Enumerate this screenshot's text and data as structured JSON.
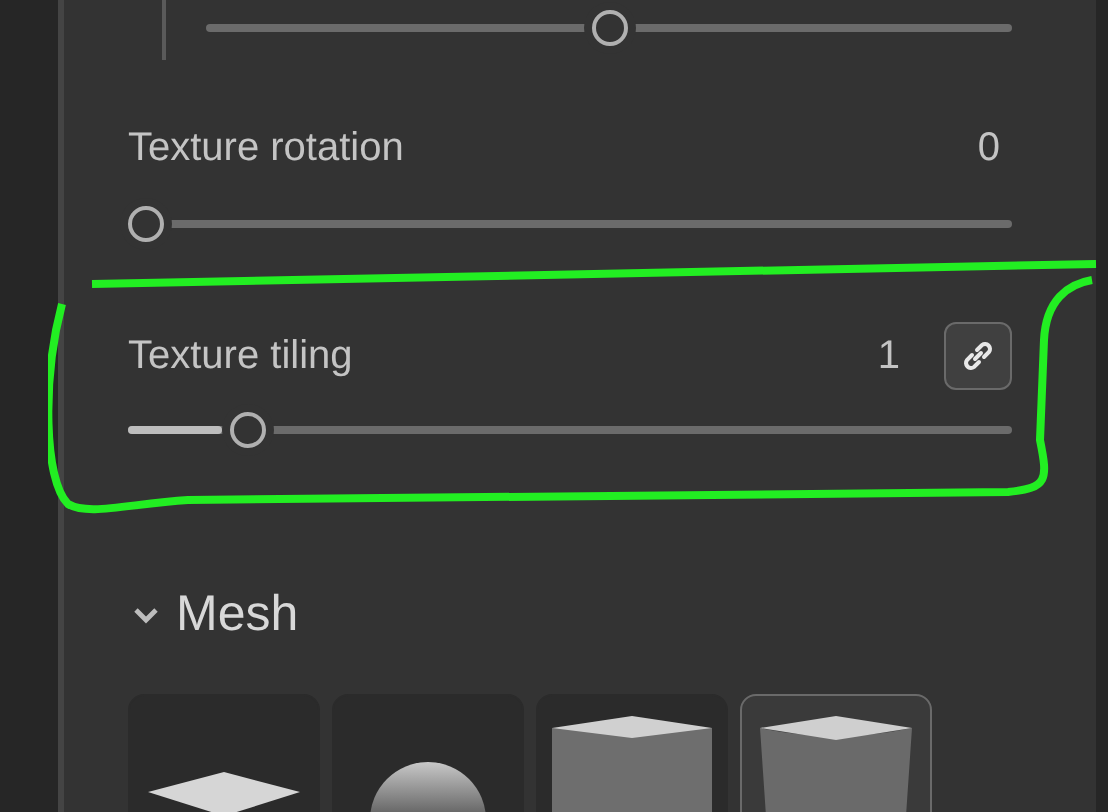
{
  "top_slider": {
    "level": 0.5
  },
  "properties": [
    {
      "label": "Texture rotation",
      "value": "0",
      "level": 0,
      "linked": false
    },
    {
      "label": "Texture tiling",
      "value": "1",
      "level": 0.12,
      "linked": true
    }
  ],
  "mesh": {
    "title": "Mesh",
    "expanded": true,
    "items": [
      {
        "kind": "plane",
        "selected": false
      },
      {
        "kind": "sphere",
        "selected": false
      },
      {
        "kind": "cube",
        "selected": false
      },
      {
        "kind": "cylinder",
        "selected": true
      }
    ]
  }
}
